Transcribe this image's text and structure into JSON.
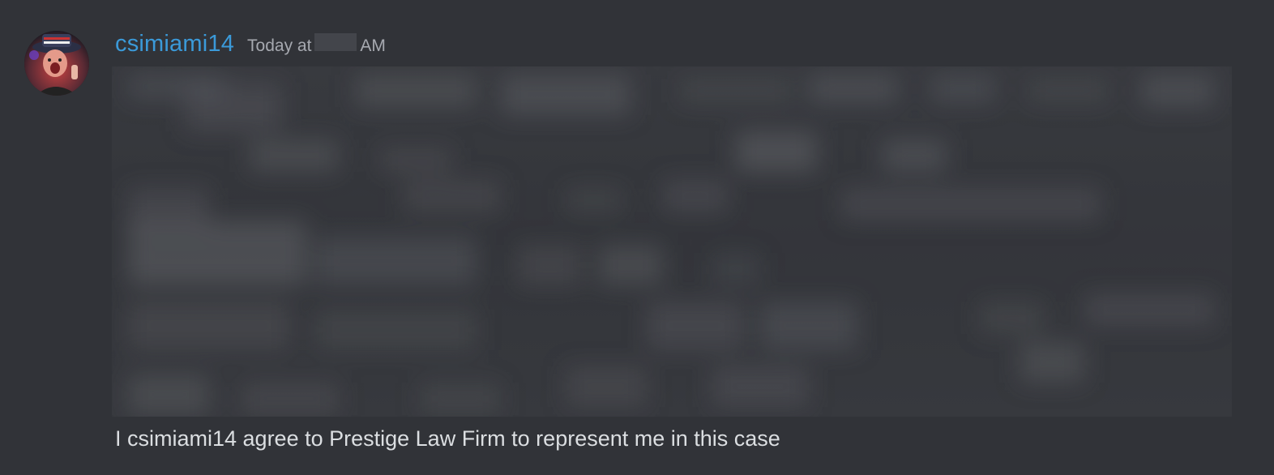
{
  "message": {
    "username": "csimiami14",
    "timestamp_prefix": "Today at",
    "timestamp_suffix": "AM",
    "content": "I csimiami14 agree to Prestige Law Firm to represent me in this case",
    "attachment": {
      "type": "image",
      "state": "blurred"
    },
    "avatar_icon": "user-avatar"
  },
  "colors": {
    "background": "#313338",
    "username": "#3b9ad9",
    "timestamp": "#a6a9b0",
    "text": "#dbdee1"
  }
}
